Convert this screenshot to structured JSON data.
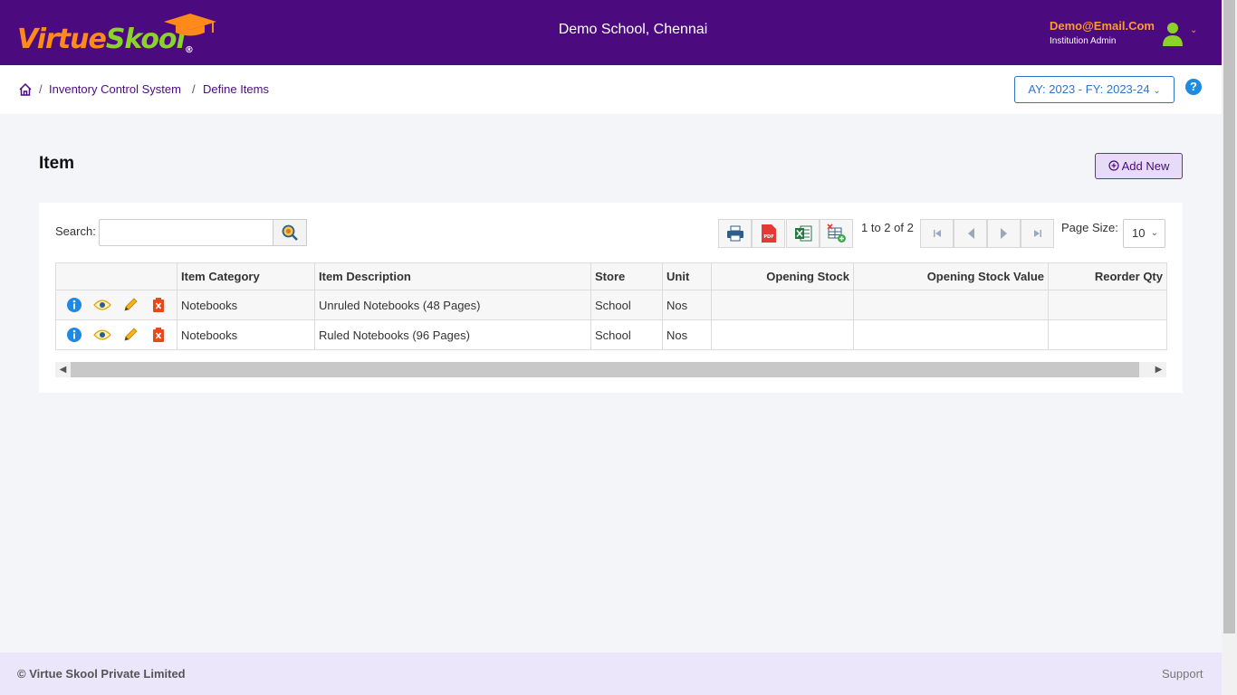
{
  "header": {
    "logo_part1": "Virtue",
    "logo_part2": "Skool",
    "logo_reg": "®",
    "school_name": "Demo School, Chennai",
    "user_email": "Demo@Email.Com",
    "user_role": "Institution Admin"
  },
  "breadcrumb": {
    "items": [
      "Inventory Control System",
      "Define Items"
    ],
    "separator": "/"
  },
  "academic_year": "AY: 2023 - FY: 2023-24",
  "help_label": "?",
  "page": {
    "title": "Item",
    "add_button": "Add New"
  },
  "toolbar": {
    "search_label": "Search:",
    "search_value": "",
    "pager_text": "1 to 2 of 2",
    "page_size_label": "Page Size:",
    "page_size_value": "10"
  },
  "table": {
    "columns": [
      "",
      "Item Category",
      "Item Description",
      "Store",
      "Unit",
      "Opening Stock",
      "Opening Stock Value",
      "Reorder Qty"
    ],
    "rows": [
      [
        "Notebooks",
        "Unruled Notebooks (48 Pages)",
        "School",
        "Nos",
        "",
        "",
        ""
      ],
      [
        "Notebooks",
        "Ruled Notebooks (96 Pages)",
        "School",
        "Nos",
        "",
        "",
        ""
      ]
    ]
  },
  "footer": {
    "copyright": "© Virtue Skool Private Limited",
    "support": "Support"
  },
  "colors": {
    "brand_purple": "#4b0a7e",
    "logo_orange": "#ff8a1c",
    "logo_green": "#8bd32a",
    "accent_blue": "#2f74c9"
  },
  "icons": [
    "graduation-cap-icon",
    "user-avatar-icon",
    "home-icon",
    "help-icon",
    "plus-circle-icon",
    "search-icon",
    "print-icon",
    "pdf-icon",
    "excel-icon",
    "column-settings-icon",
    "first-page-icon",
    "prev-page-icon",
    "next-page-icon",
    "last-page-icon",
    "info-icon",
    "view-icon",
    "edit-icon",
    "delete-icon"
  ]
}
